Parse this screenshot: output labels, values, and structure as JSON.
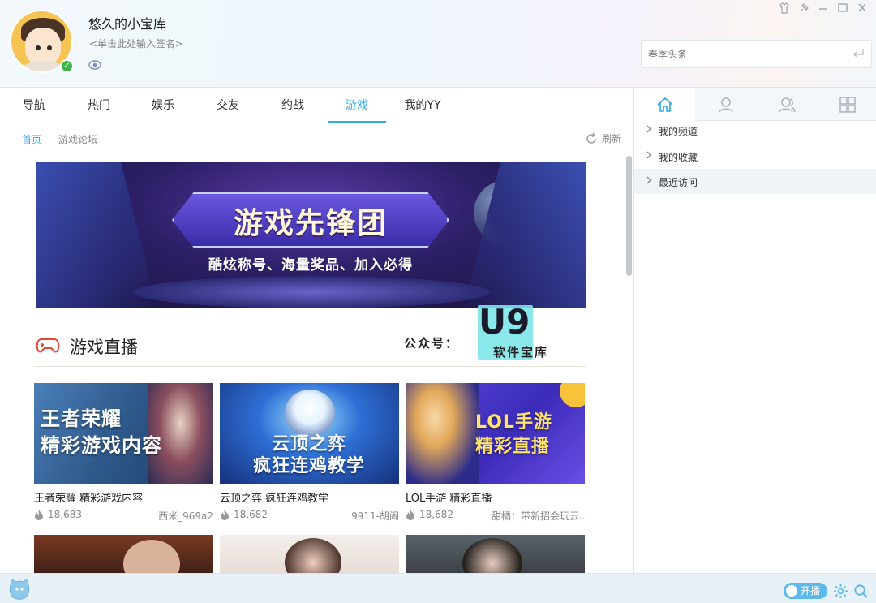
{
  "user": {
    "nickname": "悠久的小宝库",
    "signature": "<单击此处输入签名>"
  },
  "window_controls": [
    "skin-icon",
    "pin-icon",
    "minimize-icon",
    "maximize-icon",
    "close-icon"
  ],
  "search": {
    "placeholder": "春季头条"
  },
  "nav": {
    "tabs": [
      {
        "label": "导航"
      },
      {
        "label": "热门"
      },
      {
        "label": "娱乐"
      },
      {
        "label": "交友"
      },
      {
        "label": "约战"
      },
      {
        "label": "游戏",
        "active": true
      },
      {
        "label": "我的YY"
      }
    ]
  },
  "subnav": {
    "items": [
      {
        "label": "首页",
        "active": true
      },
      {
        "label": "游戏论坛"
      }
    ],
    "refresh_label": "刷新"
  },
  "banner": {
    "title": "游戏先锋团",
    "subtitle": "酷炫称号、海量奖品、加入必得"
  },
  "section": {
    "title": "游戏直播"
  },
  "watermark": {
    "label": "公众号：",
    "brand": "U9",
    "sub": "软件宝库"
  },
  "cards": [
    {
      "thumb_text": "王者荣耀\n精彩游戏内容",
      "title": "王者荣耀 精彩游戏内容",
      "viewers": "18,683",
      "host": "西米_969a2"
    },
    {
      "thumb_text": "云顶之弈\n疯狂连鸡教学",
      "title": "云顶之弈 疯狂连鸡教学",
      "viewers": "18,682",
      "host": "9911-胡闹"
    },
    {
      "thumb_text": "LOL手游\n精彩直播",
      "title": "LOL手游 精彩直播",
      "viewers": "18,682",
      "host": "甜橘：带新招会玩云..."
    }
  ],
  "right_panel": {
    "tabs": [
      "home-icon",
      "contact-icon",
      "friends-icon",
      "apps-icon"
    ],
    "tree": [
      {
        "label": "我的频道"
      },
      {
        "label": "我的收藏"
      },
      {
        "label": "最近访问",
        "highlighted": true
      }
    ]
  },
  "statusbar": {
    "live_label": "开播"
  },
  "colors": {
    "accent": "#2fa9e8",
    "online": "#3bb54a"
  }
}
